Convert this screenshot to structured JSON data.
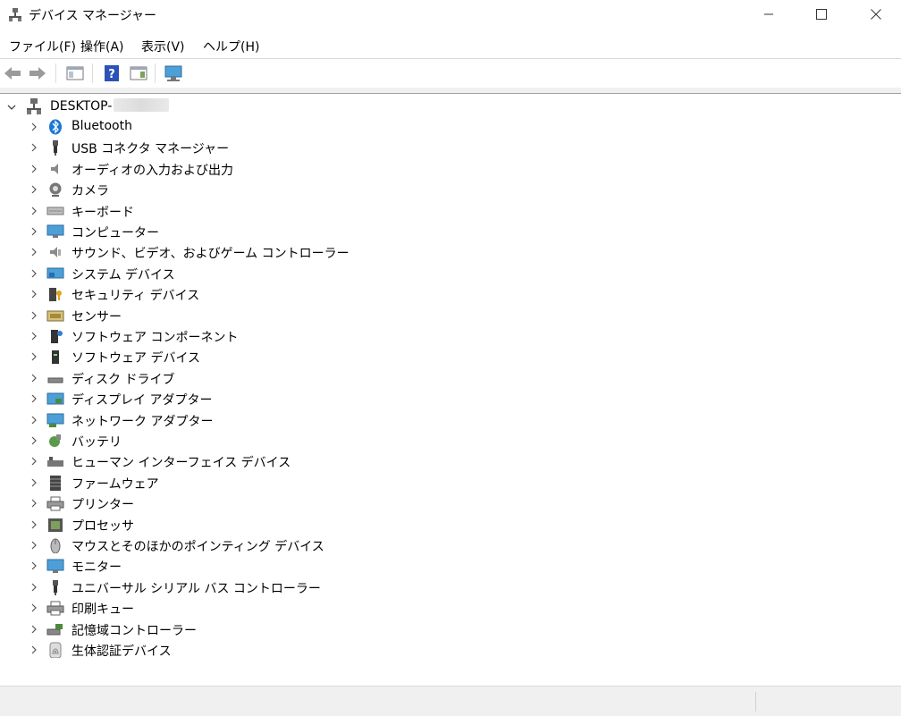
{
  "window": {
    "title": "デバイス マネージャー"
  },
  "menu": {
    "file": "ファイル(F)",
    "action": "操作(A)",
    "view": "表示(V)",
    "help": "ヘルプ(H)"
  },
  "toolbar": {
    "icons": [
      "back-arrow-icon",
      "forward-arrow-icon",
      "show-hide-console-tree-icon",
      "help-icon",
      "properties-icon",
      "scan-hardware-icon"
    ]
  },
  "tree": {
    "root_label": "DESKTOP-",
    "categories": [
      {
        "label": "Bluetooth",
        "icon": "bluetooth-icon"
      },
      {
        "label": "USB コネクタ マネージャー",
        "icon": "usb-plug-icon"
      },
      {
        "label": "オーディオの入力および出力",
        "icon": "speaker-icon"
      },
      {
        "label": "カメラ",
        "icon": "camera-icon"
      },
      {
        "label": "キーボード",
        "icon": "keyboard-icon"
      },
      {
        "label": "コンピューター",
        "icon": "computer-icon"
      },
      {
        "label": "サウンド、ビデオ、およびゲーム コントローラー",
        "icon": "sound-icon"
      },
      {
        "label": "システム デバイス",
        "icon": "system-device-icon"
      },
      {
        "label": "セキュリティ デバイス",
        "icon": "security-device-icon"
      },
      {
        "label": "センサー",
        "icon": "sensor-icon"
      },
      {
        "label": "ソフトウェア コンポーネント",
        "icon": "software-component-icon"
      },
      {
        "label": "ソフトウェア デバイス",
        "icon": "software-device-icon"
      },
      {
        "label": "ディスク ドライブ",
        "icon": "disk-drive-icon"
      },
      {
        "label": "ディスプレイ アダプター",
        "icon": "display-adapter-icon"
      },
      {
        "label": "ネットワーク アダプター",
        "icon": "network-adapter-icon"
      },
      {
        "label": "バッテリ",
        "icon": "battery-icon"
      },
      {
        "label": "ヒューマン インターフェイス デバイス",
        "icon": "hid-icon"
      },
      {
        "label": "ファームウェア",
        "icon": "firmware-icon"
      },
      {
        "label": "プリンター",
        "icon": "printer-icon"
      },
      {
        "label": "プロセッサ",
        "icon": "processor-icon"
      },
      {
        "label": "マウスとそのほかのポインティング デバイス",
        "icon": "mouse-icon"
      },
      {
        "label": "モニター",
        "icon": "monitor-icon"
      },
      {
        "label": "ユニバーサル シリアル バス コントローラー",
        "icon": "usb-controller-icon"
      },
      {
        "label": "印刷キュー",
        "icon": "print-queue-icon"
      },
      {
        "label": "記憶域コントローラー",
        "icon": "storage-controller-icon"
      },
      {
        "label": "生体認証デバイス",
        "icon": "biometric-icon"
      }
    ]
  }
}
